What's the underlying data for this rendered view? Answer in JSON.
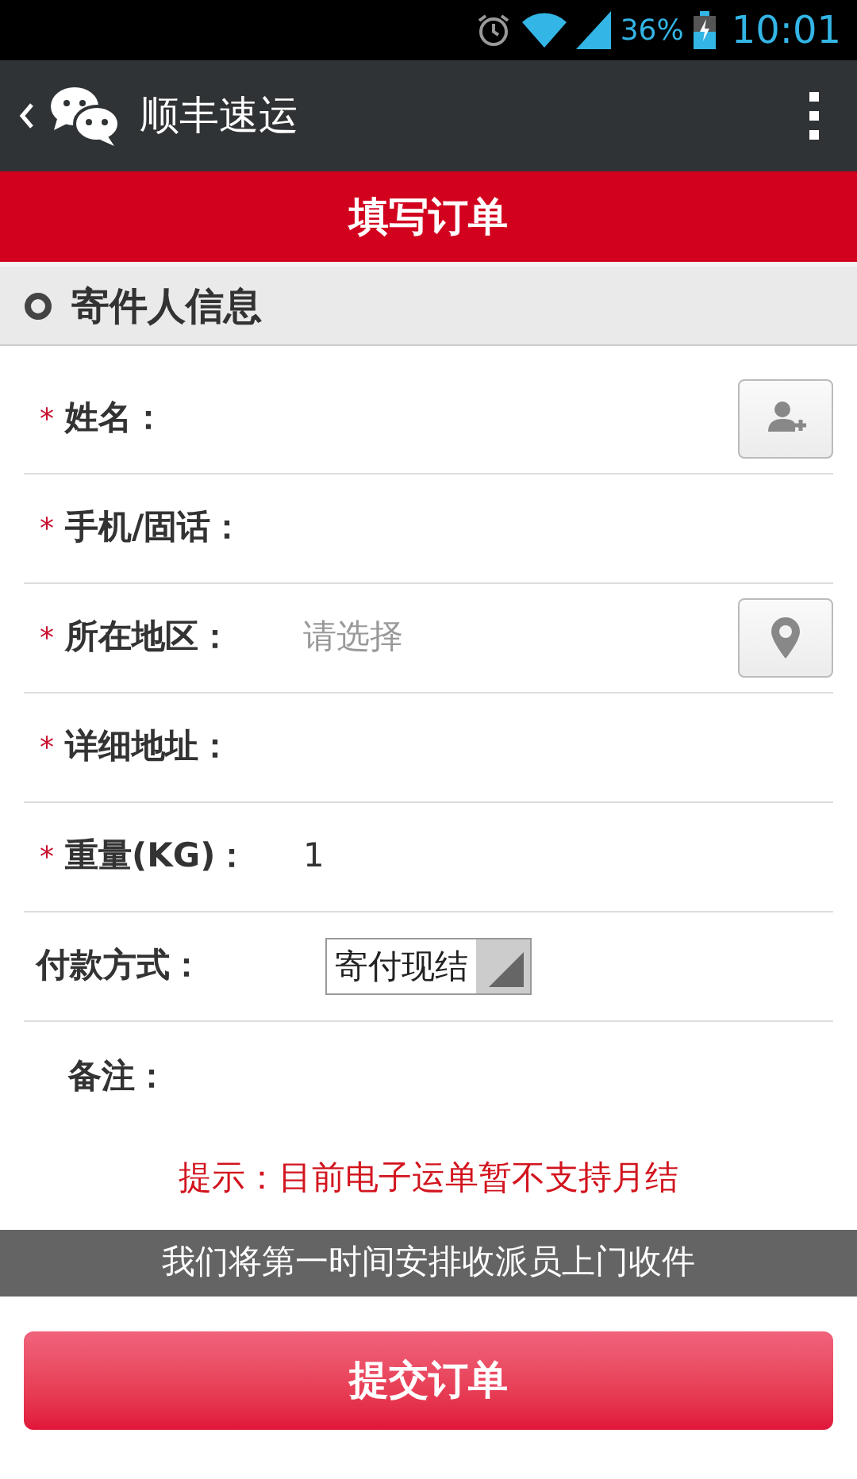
{
  "status_bar": {
    "battery": "36%",
    "time": "10:01"
  },
  "app_bar": {
    "title": "顺丰速运"
  },
  "header": {
    "title": "填写订单"
  },
  "section": {
    "title": "寄件人信息"
  },
  "required_mark": "*",
  "fields": [
    {
      "kind": "text",
      "label": "姓名：",
      "required": true,
      "button": {
        "kind": "contact"
      }
    },
    {
      "kind": "text",
      "label": "手机/固话：",
      "required": true
    },
    {
      "kind": "text",
      "label": "所在地区：",
      "required": true,
      "placeholder": "请选择",
      "button": {
        "kind": "location"
      }
    },
    {
      "kind": "text",
      "label": "详细地址：",
      "required": true
    },
    {
      "kind": "text",
      "label": "重量(KG)：",
      "required": true,
      "value": "1"
    },
    {
      "kind": "select",
      "label": "付款方式：",
      "required": false,
      "value": "寄付现结"
    },
    {
      "kind": "note",
      "label": "备注：",
      "required": false
    }
  ],
  "tip": "提示：目前电子运单暂不支持月结",
  "notice": "我们将第一时间安排收派员上门收件",
  "submit": "提交订单"
}
